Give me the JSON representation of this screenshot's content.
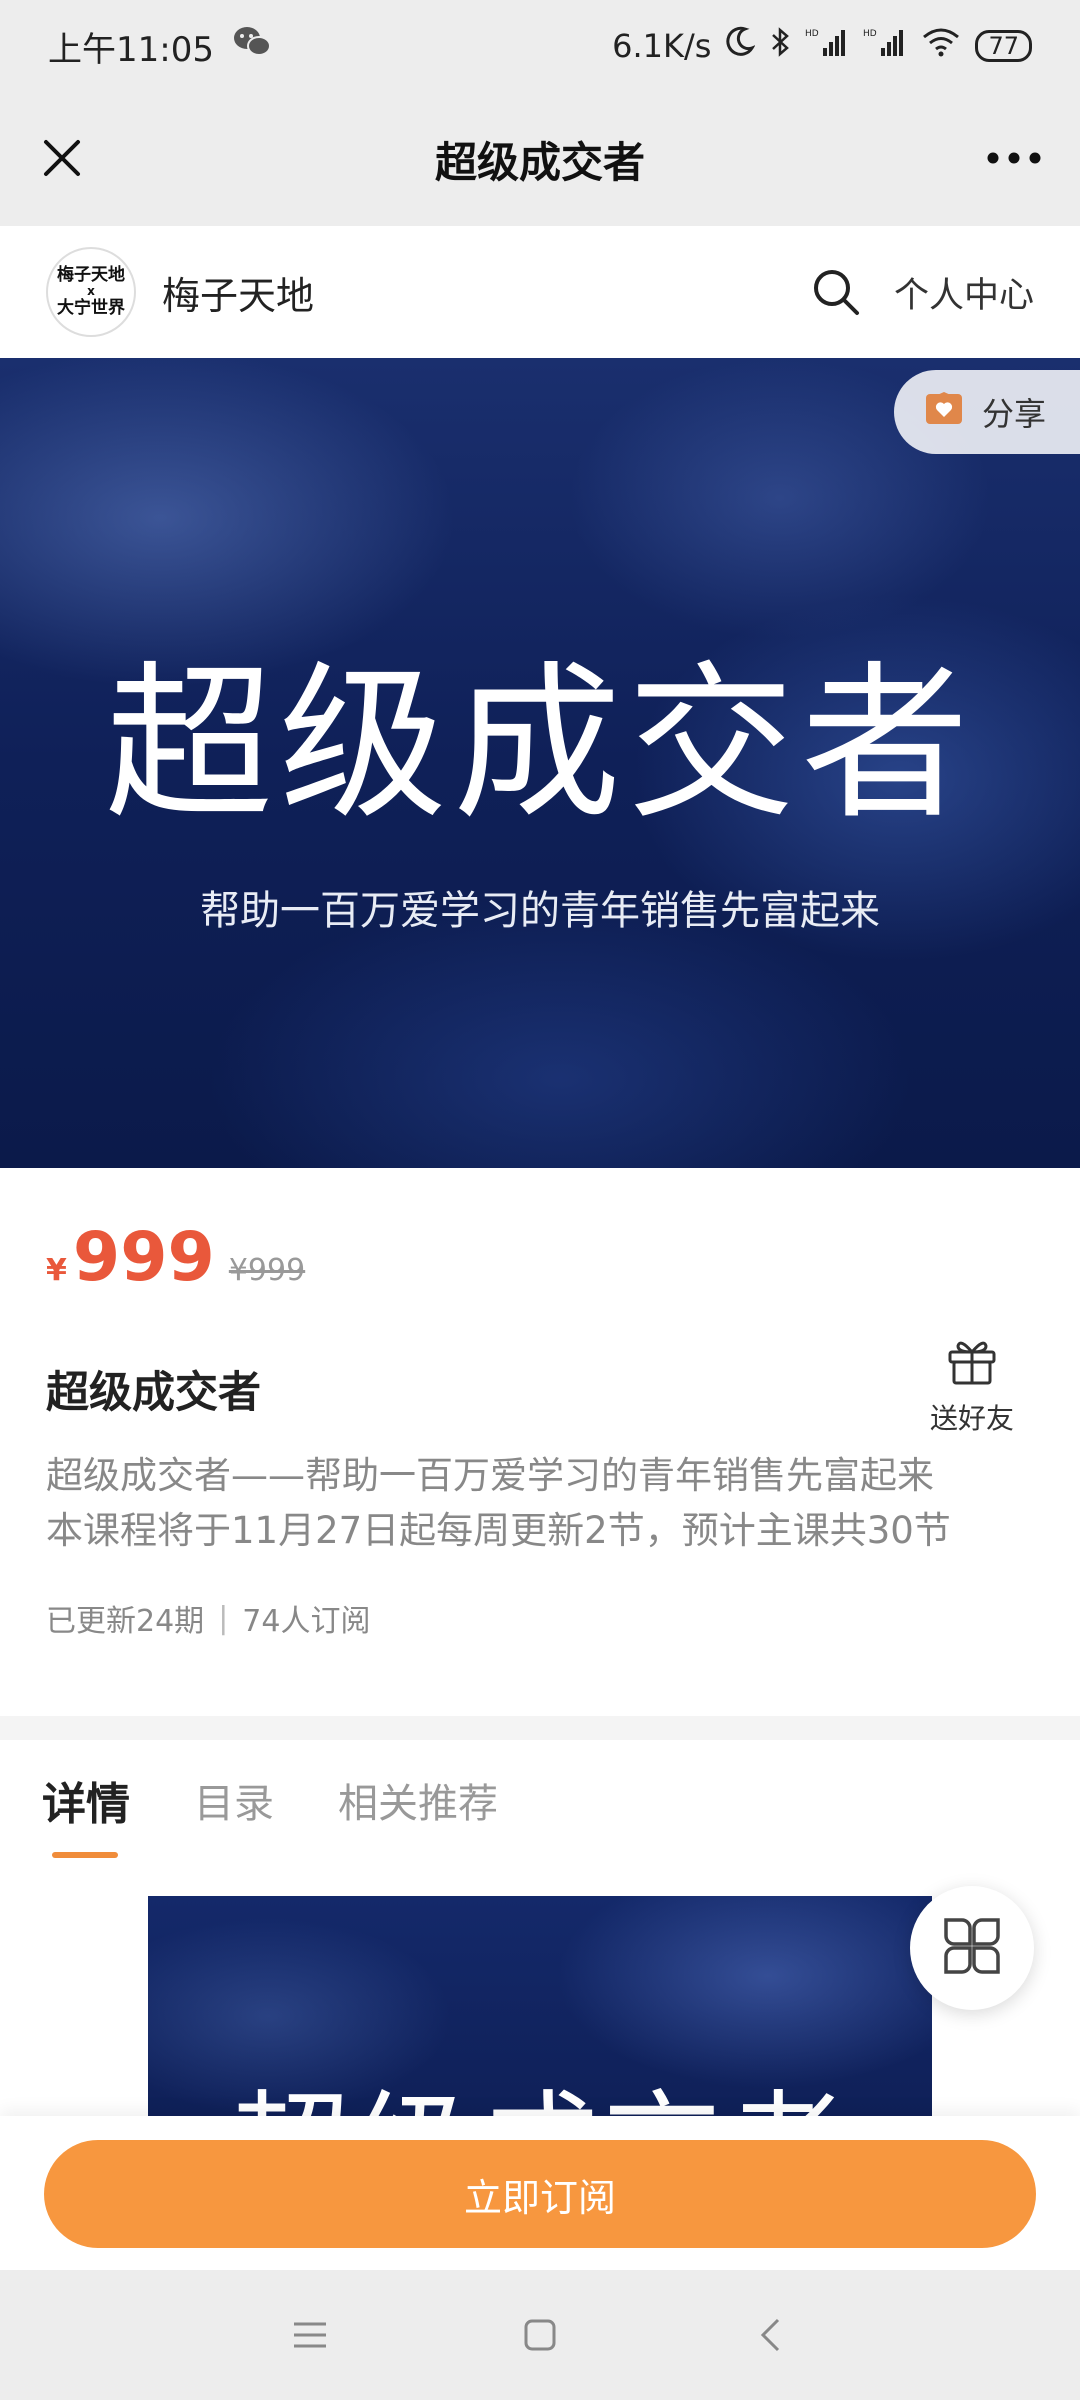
{
  "status_bar": {
    "time": "上午11:05",
    "network_speed": "6.1K/s",
    "battery": "77",
    "icons": [
      "wechat-icon",
      "moon-icon",
      "bluetooth-icon",
      "signal-icon",
      "wifi-icon",
      "battery-icon"
    ]
  },
  "nav": {
    "title": "超级成交者",
    "close_icon": "close-icon",
    "more_icon": "more-icon"
  },
  "shop": {
    "logo_line1": "梅子天地",
    "logo_x": "x",
    "logo_line2": "大宁世界",
    "name": "梅子天地",
    "search_icon": "search-icon",
    "personal_center": "个人中心"
  },
  "banner": {
    "title": "超级成交者",
    "subtitle": "帮助一百万爱学习的青年销售先富起来",
    "share_label": "分享"
  },
  "product": {
    "currency": "¥",
    "price": "999",
    "original_price": "¥999",
    "title": "超级成交者",
    "gift_label": "送好友",
    "description_line1": "超级成交者——帮助一百万爱学习的青年销售先富起来",
    "description_line2": "本课程将于11月27日起每周更新2节，预计主课共30节",
    "updated": "已更新24期",
    "separator": "|",
    "subscribers": "74人订阅"
  },
  "tabs": [
    {
      "label": "详情",
      "active": true
    },
    {
      "label": "目录",
      "active": false
    },
    {
      "label": "相关推荐",
      "active": false
    }
  ],
  "detail": {
    "image_text": "超级成交者"
  },
  "actions": {
    "subscribe_label": "立即订阅"
  },
  "colors": {
    "price": "#e9583b",
    "accent": "#f7973f",
    "tab_indicator": "#f08c3a"
  }
}
